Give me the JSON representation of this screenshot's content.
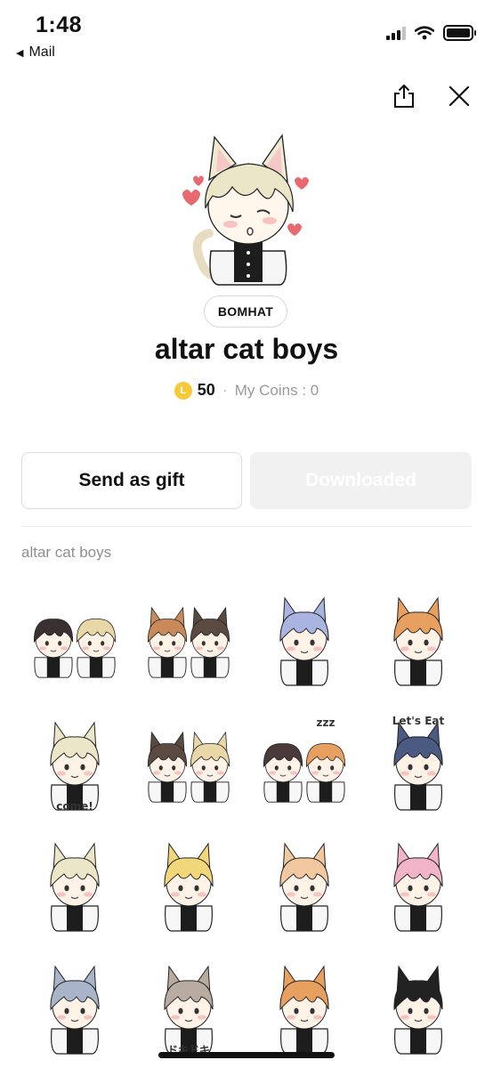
{
  "status_bar": {
    "time": "1:48",
    "back_label": "Mail"
  },
  "header": {
    "share_icon": "share-icon",
    "close_icon": "close-icon"
  },
  "pack": {
    "author": "BOMHAT",
    "title": "altar cat boys",
    "coin_letter": "L",
    "price": "50",
    "my_coins": "My Coins : 0"
  },
  "buttons": {
    "gift": "Send as gift",
    "downloaded": "Downloaded"
  },
  "section": {
    "label": "altar cat boys"
  },
  "colors": {
    "coin": "#f6c93b",
    "downloaded_bg": "#f1f1f1",
    "muted_text": "#8f8f8f"
  },
  "stickers": [
    {
      "name": "two-boys-walking",
      "hair": [
        "#3a3030",
        "#e8d8a8"
      ],
      "ears": false,
      "text": ""
    },
    {
      "name": "two-boys-flowers",
      "hair": [
        "#c88a5a",
        "#5a4a40"
      ],
      "ears": true,
      "text": ""
    },
    {
      "name": "boy-kneeling-table",
      "hair": [
        "#a9b4e0"
      ],
      "ears": true,
      "text": ""
    },
    {
      "name": "boy-drinking-wine",
      "hair": [
        "#e8a060"
      ],
      "ears": true,
      "text": ""
    },
    {
      "name": "boy-come",
      "hair": [
        "#ece6c8"
      ],
      "ears": true,
      "text": "come!"
    },
    {
      "name": "boys-hugging",
      "hair": [
        "#5a4a40",
        "#e8d8a8"
      ],
      "ears": true,
      "text": ""
    },
    {
      "name": "boys-sleeping",
      "hair": [
        "#4a3a3a",
        "#e8a060"
      ],
      "ears": false,
      "text": "zzz"
    },
    {
      "name": "lets-eat",
      "hair": [
        "#4a5a80"
      ],
      "ears": true,
      "text": "Let's Eat"
    },
    {
      "name": "blond-boy-blush",
      "hair": [
        "#ece6c8"
      ],
      "ears": true,
      "text": ""
    },
    {
      "name": "yellow-boy-crying",
      "hair": [
        "#f2d77a"
      ],
      "ears": true,
      "text": ""
    },
    {
      "name": "pink-blond-boy",
      "hair": [
        "#f2c8a0"
      ],
      "ears": true,
      "text": ""
    },
    {
      "name": "pink-hair-boy",
      "hair": [
        "#f2b4c8"
      ],
      "ears": true,
      "text": ""
    },
    {
      "name": "grey-boy-smile",
      "hair": [
        "#a8b4c8"
      ],
      "ears": true,
      "text": ""
    },
    {
      "name": "grey-brown-boy-doki",
      "hair": [
        "#b8aca0"
      ],
      "ears": true,
      "text": "ドキドキ"
    },
    {
      "name": "orange-boy-happy",
      "hair": [
        "#e8a060"
      ],
      "ears": true,
      "text": ""
    },
    {
      "name": "black-hair-boy",
      "hair": [
        "#222222"
      ],
      "ears": true,
      "text": ""
    }
  ]
}
